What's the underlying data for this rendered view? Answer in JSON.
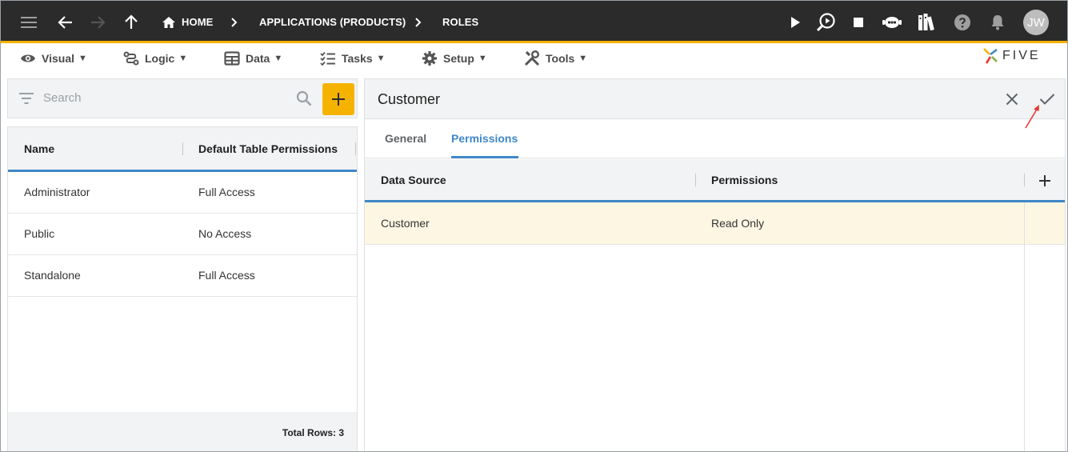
{
  "breadcrumbs": [
    "HOME",
    "APPLICATIONS (PRODUCTS)",
    "ROLES"
  ],
  "user": {
    "initials": "JW"
  },
  "menu": [
    {
      "label": "Visual",
      "icon": "eye-icon"
    },
    {
      "label": "Logic",
      "icon": "logic-flow-icon"
    },
    {
      "label": "Data",
      "icon": "table-icon"
    },
    {
      "label": "Tasks",
      "icon": "checklist-icon"
    },
    {
      "label": "Setup",
      "icon": "gear-icon"
    },
    {
      "label": "Tools",
      "icon": "tools-icon"
    }
  ],
  "menu_caret": "▼",
  "brand": {
    "name": "FIVE"
  },
  "search": {
    "placeholder": "Search"
  },
  "list": {
    "columns": [
      "Name",
      "Default Table Permissions"
    ],
    "rows": [
      {
        "name": "Administrator",
        "permission": "Full Access"
      },
      {
        "name": "Public",
        "permission": "No Access"
      },
      {
        "name": "Standalone",
        "permission": "Full Access"
      }
    ],
    "footer": "Total Rows: 3"
  },
  "form": {
    "title": "Customer",
    "tabs": [
      "General",
      "Permissions"
    ],
    "active_tab": "Permissions",
    "grid": {
      "columns": [
        "Data Source",
        "Permissions"
      ],
      "rows": [
        {
          "data_source": "Customer",
          "permissions": "Read Only"
        }
      ]
    }
  },
  "colors": {
    "accent": "#f5b300",
    "primary": "#3f87c7",
    "topbar": "#2b2b2b",
    "selected_row": "#fdf6e3"
  }
}
